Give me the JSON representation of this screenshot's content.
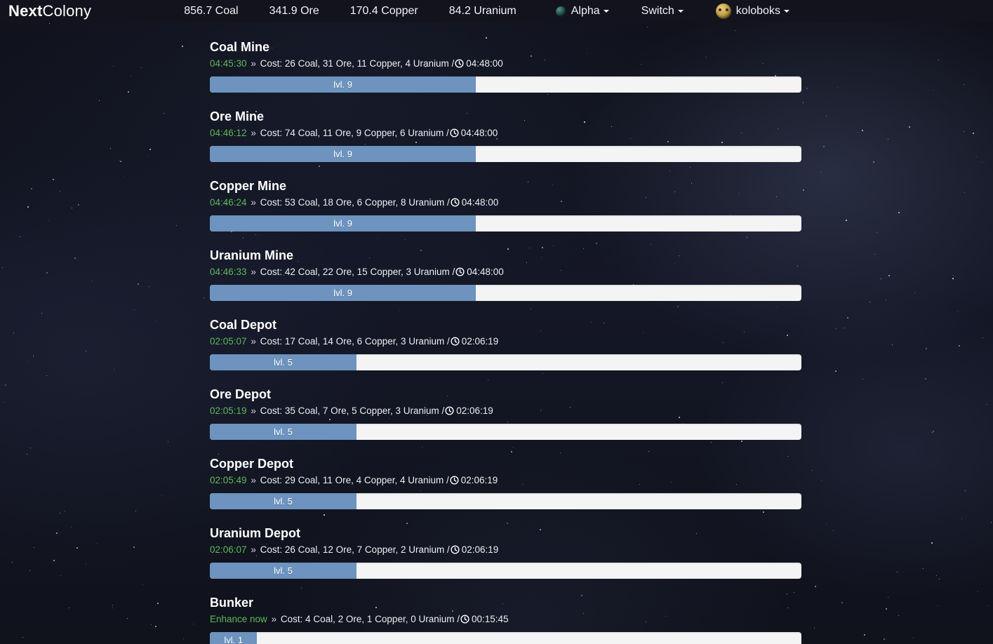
{
  "navbar": {
    "brand_bold": "Next",
    "brand_light": "Colony",
    "resources": [
      {
        "label": "856.7 Coal"
      },
      {
        "label": "341.9 Ore"
      },
      {
        "label": "170.4 Copper"
      },
      {
        "label": "84.2 Uranium"
      }
    ],
    "planet_menu": {
      "label": "Alpha",
      "icon": "planet-icon"
    },
    "switch_menu": {
      "label": "Switch"
    },
    "user_menu": {
      "label": "koloboks",
      "icon": "avatar"
    }
  },
  "colors": {
    "background": "#11131d",
    "navbar": "#12131c",
    "progress_fill": "#6d93be",
    "progress_track": "#f4f4f4",
    "timer_green": "#5cb85c",
    "title_white": "#ffffff"
  },
  "buildings": [
    {
      "name": "Coal Mine",
      "timer": "04:45:30",
      "separator": "»",
      "cost": "Cost: 26 Coal, 31 Ore, 11 Copper, 4 Uranium /",
      "duration": "04:48:00",
      "level_label": "lvl. 9",
      "level": 9,
      "progress_pct": 45
    },
    {
      "name": "Ore Mine",
      "timer": "04:46:12",
      "separator": "»",
      "cost": "Cost: 74 Coal, 11 Ore, 9 Copper, 6 Uranium /",
      "duration": "04:48:00",
      "level_label": "lvl. 9",
      "level": 9,
      "progress_pct": 45
    },
    {
      "name": "Copper Mine",
      "timer": "04:46:24",
      "separator": "»",
      "cost": "Cost: 53 Coal, 18 Ore, 6 Copper, 8 Uranium /",
      "duration": "04:48:00",
      "level_label": "lvl. 9",
      "level": 9,
      "progress_pct": 45
    },
    {
      "name": "Uranium Mine",
      "timer": "04:46:33",
      "separator": "»",
      "cost": "Cost: 42 Coal, 22 Ore, 15 Copper, 3 Uranium /",
      "duration": "04:48:00",
      "level_label": "lvl. 9",
      "level": 9,
      "progress_pct": 45
    },
    {
      "name": "Coal Depot",
      "timer": "02:05:07",
      "separator": "»",
      "cost": "Cost: 17 Coal, 14 Ore, 6 Copper, 3 Uranium /",
      "duration": "02:06:19",
      "level_label": "lvl. 5",
      "level": 5,
      "progress_pct": 24.8
    },
    {
      "name": "Ore Depot",
      "timer": "02:05:19",
      "separator": "»",
      "cost": "Cost: 35 Coal, 7 Ore, 5 Copper, 3 Uranium /",
      "duration": "02:06:19",
      "level_label": "lvl. 5",
      "level": 5,
      "progress_pct": 24.8
    },
    {
      "name": "Copper Depot",
      "timer": "02:05:49",
      "separator": "»",
      "cost": "Cost: 29 Coal, 11 Ore, 4 Copper, 4 Uranium /",
      "duration": "02:06:19",
      "level_label": "lvl. 5",
      "level": 5,
      "progress_pct": 24.8
    },
    {
      "name": "Uranium Depot",
      "timer": "02:06:07",
      "separator": "»",
      "cost": "Cost: 26 Coal, 12 Ore, 7 Copper, 2 Uranium /",
      "duration": "02:06:19",
      "level_label": "lvl. 5",
      "level": 5,
      "progress_pct": 24.8
    },
    {
      "name": "Bunker",
      "timer": "Enhance now",
      "timer_is_link": true,
      "separator": "»",
      "cost": "Cost: 4 Coal, 2 Ore, 1 Copper, 0 Uranium /",
      "duration": "00:15:45",
      "level_label": "lvl. 1",
      "level": 1,
      "progress_pct": 8
    }
  ]
}
